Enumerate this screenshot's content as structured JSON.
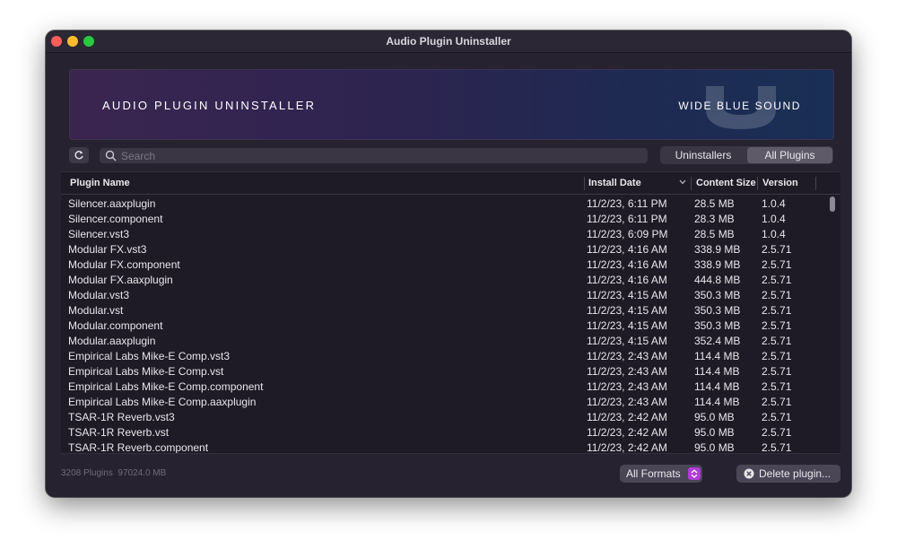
{
  "window": {
    "title": "Audio Plugin Uninstaller"
  },
  "banner": {
    "title": "AUDIO PLUGIN UNINSTALLER",
    "brand": "WIDE BLUE SOUND"
  },
  "toolbar": {
    "refresh_icon": "refresh-icon",
    "search_placeholder": "Search",
    "search_value": "",
    "tabs": [
      {
        "label": "Uninstallers",
        "selected": false
      },
      {
        "label": "All Plugins",
        "selected": true
      }
    ]
  },
  "table": {
    "columns": [
      "Plugin Name",
      "Install Date",
      "Content Size",
      "Version"
    ],
    "sorted_column": "Install Date",
    "rows": [
      {
        "name": "Silencer.aaxplugin",
        "date": "11/2/23, 6:11 PM",
        "size": "28.5 MB",
        "version": "1.0.4"
      },
      {
        "name": "Silencer.component",
        "date": "11/2/23, 6:11 PM",
        "size": "28.3 MB",
        "version": "1.0.4"
      },
      {
        "name": "Silencer.vst3",
        "date": "11/2/23, 6:09 PM",
        "size": "28.5 MB",
        "version": "1.0.4"
      },
      {
        "name": "Modular FX.vst3",
        "date": "11/2/23, 4:16 AM",
        "size": "338.9 MB",
        "version": "2.5.71"
      },
      {
        "name": "Modular FX.component",
        "date": "11/2/23, 4:16 AM",
        "size": "338.9 MB",
        "version": "2.5.71"
      },
      {
        "name": "Modular FX.aaxplugin",
        "date": "11/2/23, 4:16 AM",
        "size": "444.8 MB",
        "version": "2.5.71"
      },
      {
        "name": "Modular.vst3",
        "date": "11/2/23, 4:15 AM",
        "size": "350.3 MB",
        "version": "2.5.71"
      },
      {
        "name": "Modular.vst",
        "date": "11/2/23, 4:15 AM",
        "size": "350.3 MB",
        "version": "2.5.71"
      },
      {
        "name": "Modular.component",
        "date": "11/2/23, 4:15 AM",
        "size": "350.3 MB",
        "version": "2.5.71"
      },
      {
        "name": "Modular.aaxplugin",
        "date": "11/2/23, 4:15 AM",
        "size": "352.4 MB",
        "version": "2.5.71"
      },
      {
        "name": "Empirical Labs Mike-E Comp.vst3",
        "date": "11/2/23, 2:43 AM",
        "size": "114.4 MB",
        "version": "2.5.71"
      },
      {
        "name": "Empirical Labs Mike-E Comp.vst",
        "date": "11/2/23, 2:43 AM",
        "size": "114.4 MB",
        "version": "2.5.71"
      },
      {
        "name": "Empirical Labs Mike-E Comp.component",
        "date": "11/2/23, 2:43 AM",
        "size": "114.4 MB",
        "version": "2.5.71"
      },
      {
        "name": "Empirical Labs Mike-E Comp.aaxplugin",
        "date": "11/2/23, 2:43 AM",
        "size": "114.4 MB",
        "version": "2.5.71"
      },
      {
        "name": "TSAR-1R Reverb.vst3",
        "date": "11/2/23, 2:42 AM",
        "size": "95.0 MB",
        "version": "2.5.71"
      },
      {
        "name": "TSAR-1R Reverb.vst",
        "date": "11/2/23, 2:42 AM",
        "size": "95.0 MB",
        "version": "2.5.71"
      },
      {
        "name": "TSAR-1R Reverb.component",
        "date": "11/2/23, 2:42 AM",
        "size": "95.0 MB",
        "version": "2.5.71"
      }
    ]
  },
  "footer": {
    "status": "3208 Plugins  97024.0 MB",
    "format_label": "All Formats",
    "delete_label": "Delete plugin..."
  },
  "colors": {
    "accent": "#b13cd8",
    "window_bg": "#262230",
    "table_bg": "#1f1b26"
  }
}
